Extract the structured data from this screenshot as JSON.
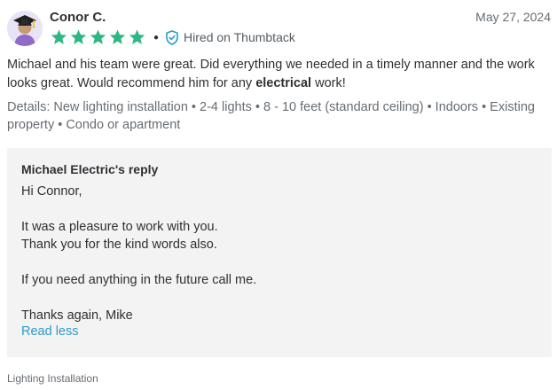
{
  "review": {
    "reviewer_name": "Conor C.",
    "date": "May 27, 2024",
    "rating": 5,
    "rating_max": 5,
    "hired_badge": "Hired on Thumbtack",
    "text_before": "Michael and his team were great. Did everything we needed in a timely manner and the work looks great. Would recommend him for any ",
    "text_highlight": "electrical",
    "text_after": " work!",
    "details": "Details: New lighting installation • 2-4 lights • 8 - 10 feet (standard ceiling) • Indoors • Existing property • Condo or apartment",
    "category": "Lighting Installation"
  },
  "reply": {
    "title": "Michael Electric's reply",
    "lines": [
      "Hi Connor,",
      "",
      "It was a pleasure to work with you.",
      "Thank you for the kind words also.",
      "",
      "If you need anything in the future call me.",
      "",
      "Thanks again, Mike"
    ],
    "read_less": "Read less"
  },
  "colors": {
    "star": "#2db783",
    "link": "#2d9bc6",
    "badge": "#2d9bc6",
    "reply_background": "#f3f3f4",
    "avatar_background": "#e9e3f7"
  },
  "icons": {
    "star": "star-icon",
    "badge": "shield-check-icon",
    "avatar": "avatar-graduate-icon"
  }
}
